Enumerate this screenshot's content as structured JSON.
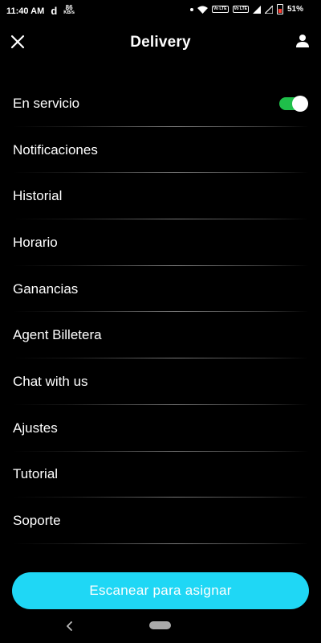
{
  "status_bar": {
    "time": "11:40 AM",
    "tiktok_glyph": "d",
    "net_speed_value": "86",
    "net_speed_unit": "KB/s",
    "volte_1": "Vo LTE",
    "volte_2": "Vo LTE",
    "battery": "51%"
  },
  "header": {
    "title": "Delivery",
    "close_icon": "close-icon",
    "profile_icon": "person-icon"
  },
  "menu": {
    "items": [
      {
        "label": "En servicio",
        "toggle": true
      },
      {
        "label": "Notificaciones"
      },
      {
        "label": "Historial"
      },
      {
        "label": "Horario"
      },
      {
        "label": "Ganancias"
      },
      {
        "label": "Agent Billetera"
      },
      {
        "label": "Chat with us"
      },
      {
        "label": "Ajustes"
      },
      {
        "label": "Tutorial"
      },
      {
        "label": "Soporte"
      }
    ]
  },
  "scan_button": {
    "label": "Escanear para asignar"
  },
  "colors": {
    "background": "#000000",
    "accent": "#1fd7f5",
    "toggle_on": "#1fbf4a"
  }
}
